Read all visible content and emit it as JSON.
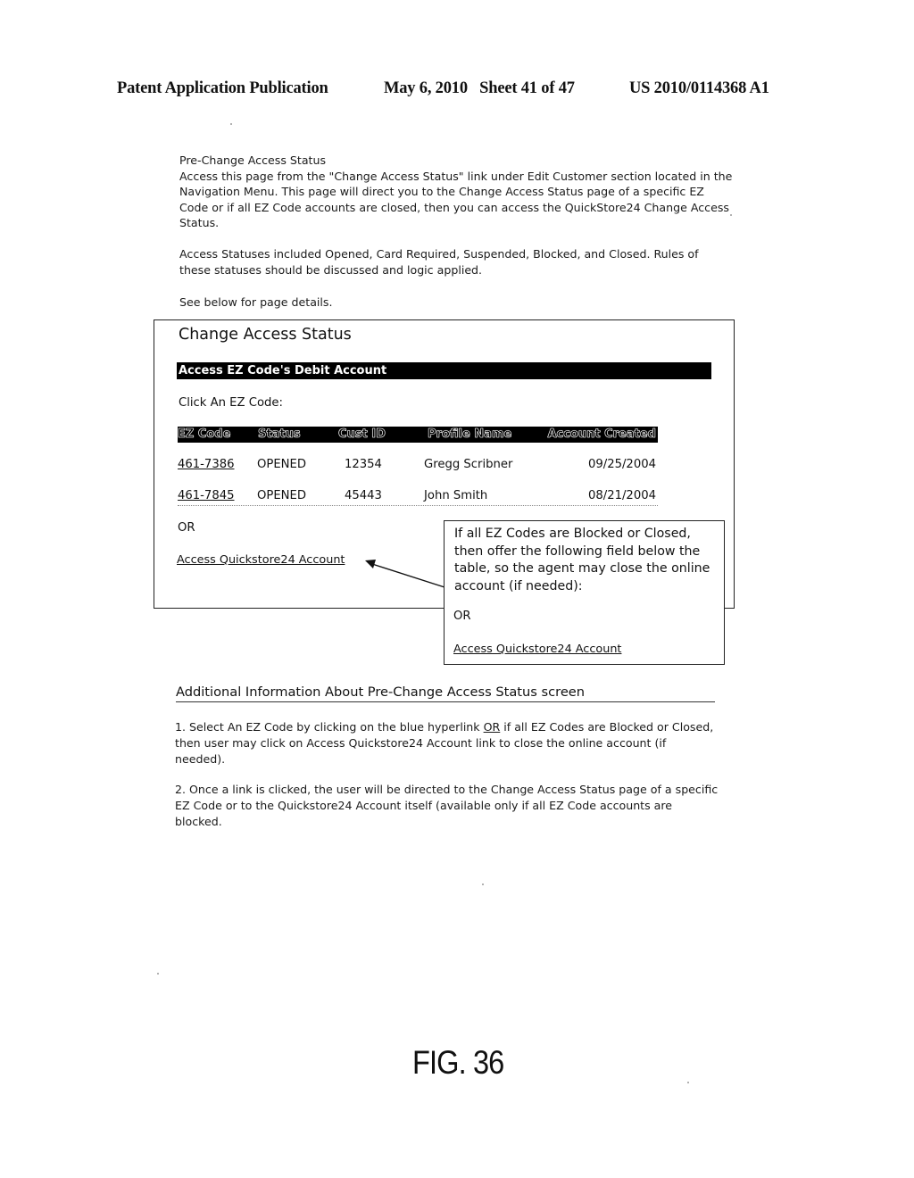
{
  "header": {
    "publication": "Patent Application Publication",
    "date_sheet": "May 6, 2010   Sheet 41 of 47",
    "number": "US 2010/0114368 A1"
  },
  "intro": {
    "heading": "Pre-Change Access Status",
    "paragraph1": "Access this page from the \"Change Access Status\" link under Edit Customer section located in the Navigation Menu.  This page will direct you to the Change Access Status page of a specific EZ Code or if all EZ Code accounts are closed, then you can access the QuickStore24 Change Access Status.",
    "paragraph2": "Access Statuses included Opened, Card Required, Suspended, Blocked, and Closed. Rules of these statuses should be discussed and logic applied.",
    "paragraph3": "See below for page details."
  },
  "screen": {
    "title": "Change Access Status",
    "section_bar": "Access EZ Code's Debit Account",
    "instruction": "Click An EZ Code:",
    "table": {
      "headers": [
        "EZ Code",
        "Status",
        "Cust ID",
        "Profile Name",
        "Account Created"
      ],
      "rows": [
        [
          "461-7386",
          "OPENED",
          "12354",
          "Gregg Scribner",
          "09/25/2004"
        ],
        [
          "461-7845",
          "OPENED",
          "45443",
          "John Smith",
          "08/21/2004"
        ]
      ]
    },
    "or_label": "OR",
    "quickstore_link": "Access Quickstore24 Account"
  },
  "callout": {
    "text": "If all EZ Codes are Blocked or Closed, then offer the following field below the table, so the agent may close the online account (if needed):",
    "or_label": "OR",
    "link": "Access Quickstore24 Account"
  },
  "additional": {
    "title": "Additional Information About Pre-Change Access Status screen",
    "item1_before": "1. Select An EZ Code by clicking on the blue hyperlink ",
    "item1_or": "OR",
    "item1_after": " if all EZ Codes are Blocked or Closed, then user may click on Access Quickstore24 Account link to close the online account (if needed).",
    "item2": "2. Once a link is clicked, the user will be directed to the Change Access Status page of a specific EZ Code or to the Quickstore24 Account itself (available only if all EZ Code accounts are blocked."
  },
  "figure_label": "FIG. 36"
}
